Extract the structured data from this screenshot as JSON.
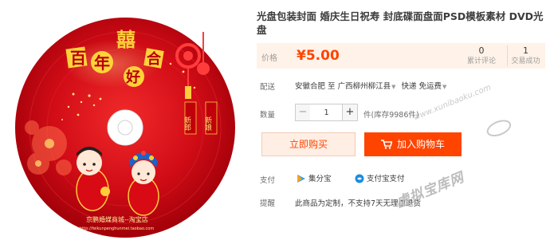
{
  "product": {
    "title": "光盘包装封面 婚庆生日祝寿 封底碟面盘面PSD模板素材 DVD光盘"
  },
  "disc_art": {
    "chars_bai_nian_hao_he": [
      "百",
      "年",
      "好",
      "合"
    ],
    "double_happiness": "囍",
    "banner_left": "新郎",
    "banner_right": "新娘",
    "shop_text": "京鹏婚媒商城--淘宝店",
    "shop_url": "http://feikunpenghunmei.taobao.com"
  },
  "price": {
    "label": "价格",
    "value": "¥5.00",
    "reviews_count": "0",
    "reviews_label": "累计评论",
    "sold_count": "1",
    "sold_label": "交易成功"
  },
  "shipping": {
    "label": "配送",
    "origin": "安徽合肥 至",
    "destination": "广西柳州柳江县",
    "method": "快递 免运费"
  },
  "quantity": {
    "label": "数量",
    "value": "1",
    "minus": "−",
    "plus": "+",
    "stock": "件(库存9986件)"
  },
  "buttons": {
    "buy_now": "立即购买",
    "add_to_cart": "加入购物车"
  },
  "payment": {
    "label": "支付",
    "methods": [
      "集分宝",
      "支付宝支付"
    ]
  },
  "reminder": {
    "label": "提醒",
    "text": "此商品为定制，不支持7天无理由退货"
  },
  "watermark": {
    "url": "www.xunibaoku.com",
    "name": "虚拟宝库网"
  },
  "colors": {
    "accent": "#ff4400",
    "price_bg": "#fff2e8",
    "disc_red": "#c8000e"
  }
}
